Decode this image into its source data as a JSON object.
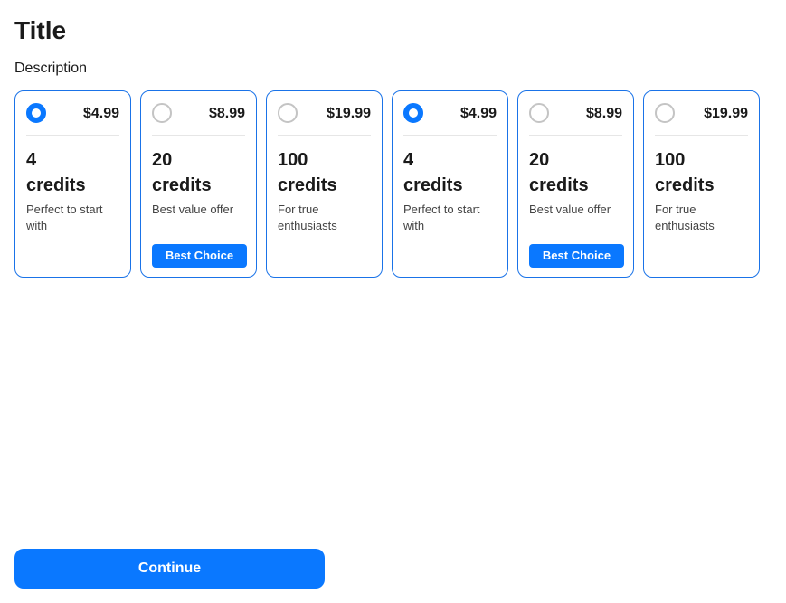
{
  "title": "Title",
  "description": "Description",
  "plans": [
    {
      "price": "$4.99",
      "amount_line1": "4",
      "amount_line2": "credits",
      "subtitle": "Perfect to start with",
      "badge": "",
      "selected": true
    },
    {
      "price": "$8.99",
      "amount_line1": "20",
      "amount_line2": "credits",
      "subtitle": "Best value offer",
      "badge": "Best Choice",
      "selected": false
    },
    {
      "price": "$19.99",
      "amount_line1": "100",
      "amount_line2": "credits",
      "subtitle": "For true enthusiasts",
      "badge": "",
      "selected": false
    },
    {
      "price": "$4.99",
      "amount_line1": "4",
      "amount_line2": "credits",
      "subtitle": "Perfect to start with",
      "badge": "",
      "selected": true
    },
    {
      "price": "$8.99",
      "amount_line1": "20",
      "amount_line2": "credits",
      "subtitle": "Best value offer",
      "badge": "Best Choice",
      "selected": false
    },
    {
      "price": "$19.99",
      "amount_line1": "100",
      "amount_line2": "credits",
      "subtitle": "For true enthusiasts",
      "badge": "",
      "selected": false
    }
  ],
  "continue_label": "Continue",
  "colors": {
    "accent": "#0a78ff",
    "card_border": "#1a73e8",
    "radio_unselected": "#c4c4c4",
    "text": "#1a1a1a"
  }
}
